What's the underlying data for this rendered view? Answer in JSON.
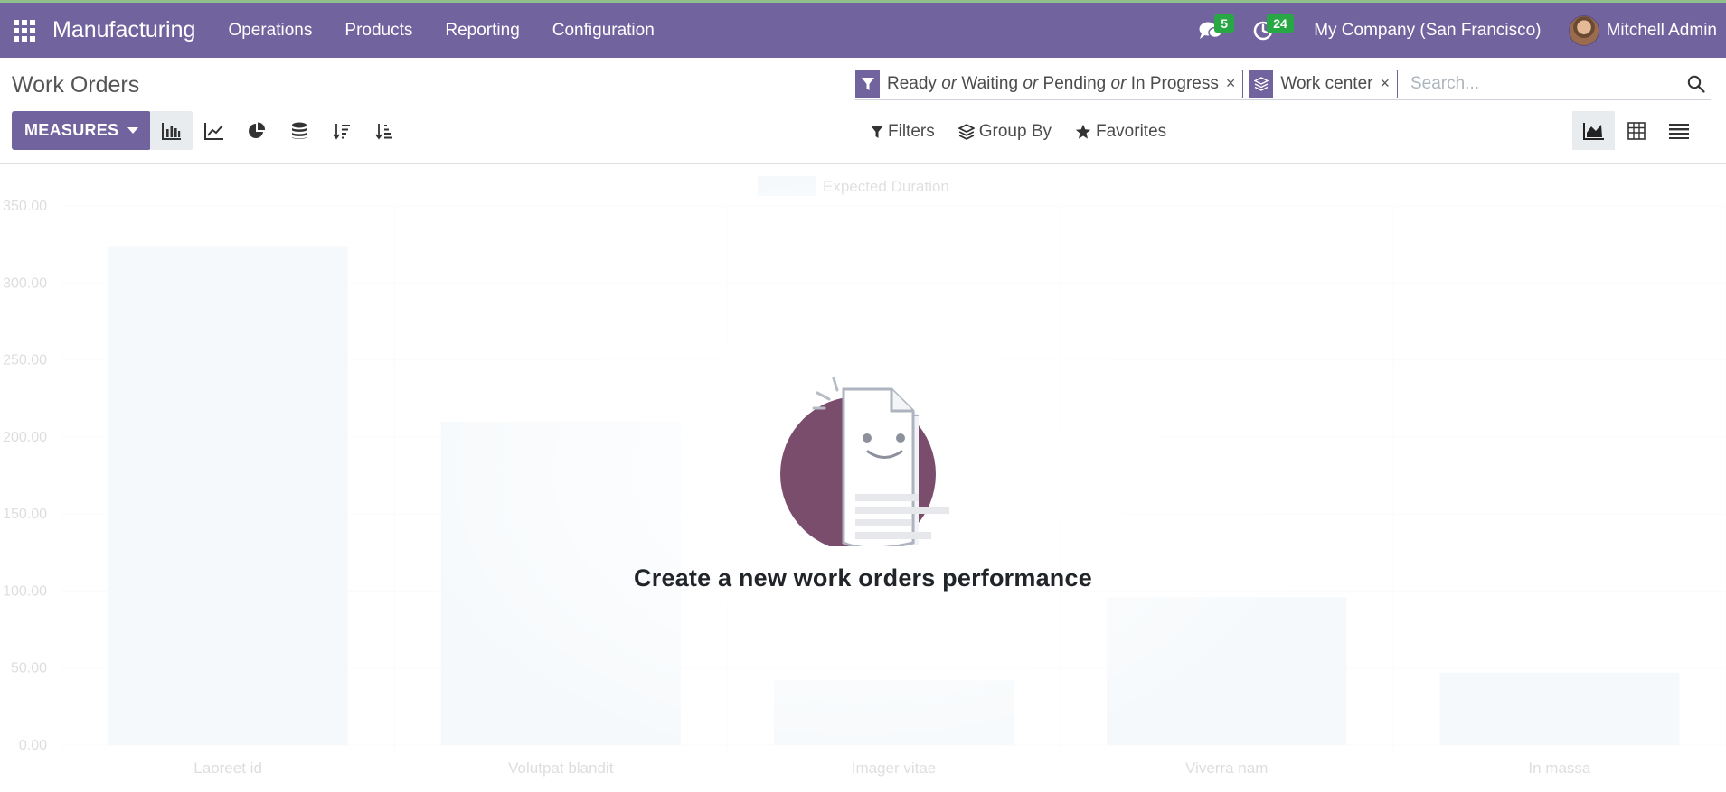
{
  "navbar": {
    "app_name": "Manufacturing",
    "menu": [
      "Operations",
      "Products",
      "Reporting",
      "Configuration"
    ],
    "messages_count": "5",
    "activities_count": "24",
    "company": "My Company (San Francisco)",
    "user": "Mitchell Admin",
    "color": "#71639e"
  },
  "control_panel": {
    "title": "Work Orders",
    "search": {
      "facets": [
        {
          "icon": "filter-icon",
          "parts": [
            "Ready",
            "or",
            "Waiting",
            "or",
            "Pending",
            "or",
            "In Progress"
          ]
        },
        {
          "icon": "layers-icon",
          "label": "Work center"
        }
      ],
      "placeholder": "Search..."
    },
    "measures_label": "MEASURES",
    "filters_label": "Filters",
    "group_by_label": "Group By",
    "favorites_label": "Favorites"
  },
  "empty_state": {
    "title": "Create a new work orders performance"
  },
  "chart_data": {
    "type": "bar",
    "categories": [
      "Laoreet id",
      "Volutpat blandit",
      "Imager vitae",
      "Viverra nam",
      "In massa"
    ],
    "series": [
      {
        "name": "Expected Duration",
        "values": [
          324,
          210,
          42,
          96,
          47
        ]
      }
    ],
    "ylim": [
      0,
      350
    ],
    "yticks": [
      "0.00",
      "50.00",
      "100.00",
      "150.00",
      "200.00",
      "250.00",
      "300.00",
      "350.00"
    ],
    "legend": "top-center",
    "grid": true,
    "bar_color": "#d6e4f0"
  }
}
